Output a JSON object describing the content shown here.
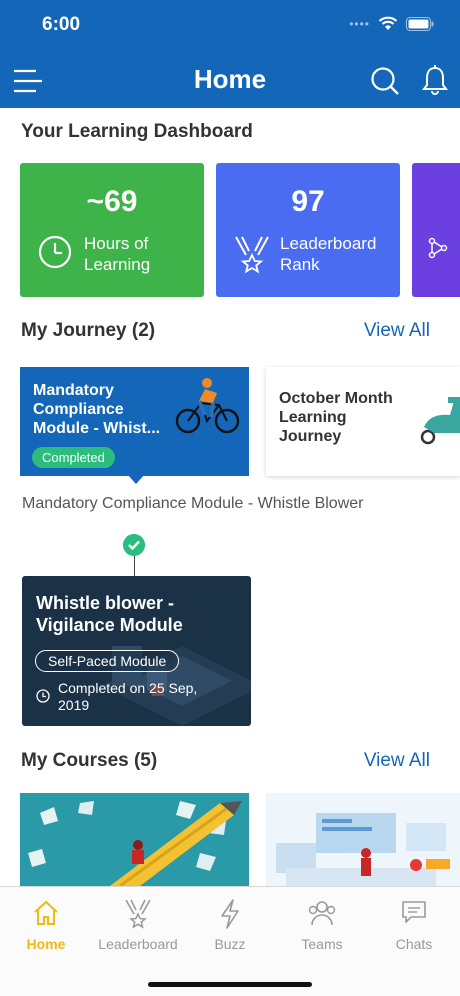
{
  "status": {
    "time": "6:00"
  },
  "header": {
    "title": "Home"
  },
  "dashboard": {
    "title": "Your Learning Dashboard",
    "cards": [
      {
        "value": "~69",
        "label_line1": "Hours of",
        "label_line2": "Learning",
        "color": "#3db34a",
        "icon": "clock-icon"
      },
      {
        "value": "97",
        "label_line1": "Leaderboard",
        "label_line2": "Rank",
        "color": "#4a6cf0",
        "icon": "medal-icon"
      },
      {
        "color": "#6b3fe0",
        "icon": "network-icon"
      }
    ]
  },
  "journey": {
    "title": "My Journey (2)",
    "view_all": "View All",
    "cards": [
      {
        "title_line1": "Mandatory",
        "title_line2": "Compliance",
        "title_line3": "Module - Whist...",
        "badge": "Completed",
        "color": "#1466b8"
      },
      {
        "title_line1": "October Month",
        "title_line2": "Learning",
        "title_line3": "Journey",
        "color": "#ffffff"
      }
    ],
    "caption": "Mandatory Compliance Module - Whistle Blower",
    "module": {
      "title_line1": "Whistle blower -",
      "title_line2": "Vigilance Module",
      "pill": "Self-Paced Module",
      "date_line1": "Completed on 25 Sep,",
      "date_line2": "2019"
    }
  },
  "courses": {
    "title": "My Courses (5)",
    "view_all": "View All"
  },
  "tabs": [
    {
      "label": "Home",
      "icon": "home-icon",
      "active": true
    },
    {
      "label": "Leaderboard",
      "icon": "medal-icon",
      "active": false
    },
    {
      "label": "Buzz",
      "icon": "lightning-icon",
      "active": false
    },
    {
      "label": "Teams",
      "icon": "people-icon",
      "active": false
    },
    {
      "label": "Chats",
      "icon": "chat-icon",
      "active": false
    }
  ],
  "colors": {
    "primary": "#1466b8",
    "success": "#2bbd7e",
    "active_tab": "#f2b90f",
    "module_dark": "#1a3146"
  }
}
